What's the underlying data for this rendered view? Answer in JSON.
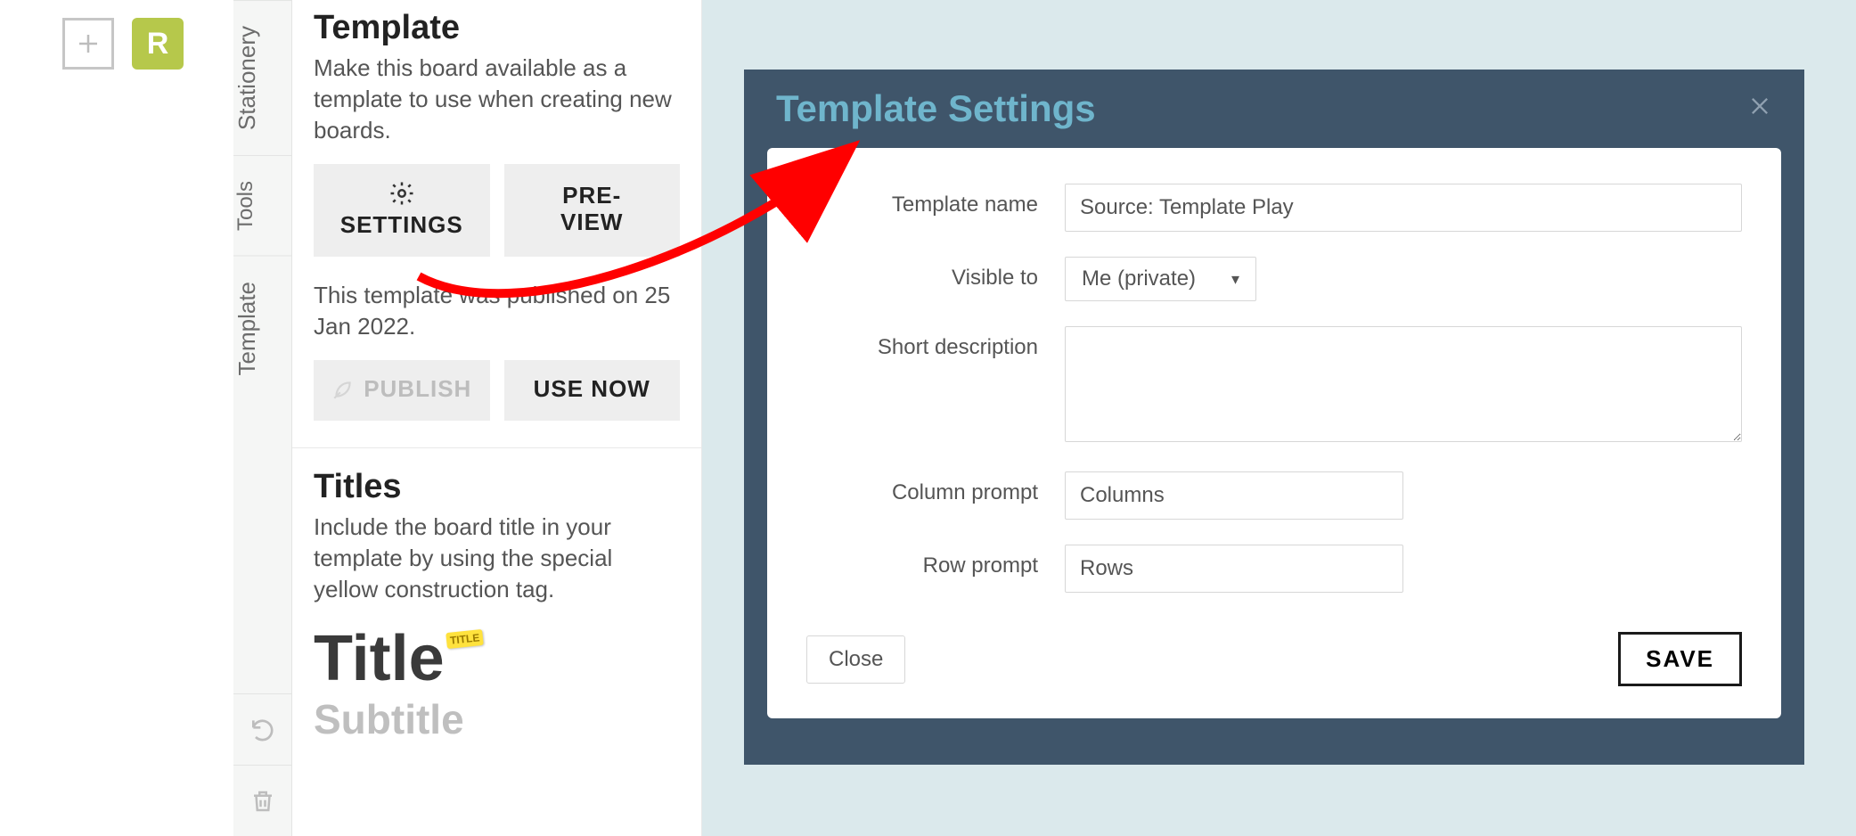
{
  "leftbar": {
    "tag_letter": "R"
  },
  "tabs": {
    "stationery": "Stationery",
    "tools": "Tools",
    "template": "Template"
  },
  "template_section": {
    "heading": "Template",
    "desc": "Make this board available as a template to use when creating new boards.",
    "settings_btn": "SETTINGS",
    "preview_btn": "PRE-\nVIEW",
    "published_note": "This template was published on 25 Jan 2022.",
    "publish_btn": "PUBLISH",
    "usenow_btn": "USE NOW"
  },
  "titles_section": {
    "heading": "Titles",
    "desc": "Include the board title in your template by using the special yellow construction tag.",
    "title_sample": "Title",
    "title_badge": "TITLE",
    "subtitle_sample": "Subtitle"
  },
  "dialog": {
    "title": "Template Settings",
    "fields": {
      "template_name": {
        "label": "Template name",
        "value": "Source: Template Play"
      },
      "visible_to": {
        "label": "Visible to",
        "value": "Me (private)"
      },
      "short_description": {
        "label": "Short description",
        "value": ""
      },
      "column_prompt": {
        "label": "Column prompt",
        "value": "Columns"
      },
      "row_prompt": {
        "label": "Row prompt",
        "value": "Rows"
      }
    },
    "close_btn": "Close",
    "save_btn": "SAVE"
  }
}
